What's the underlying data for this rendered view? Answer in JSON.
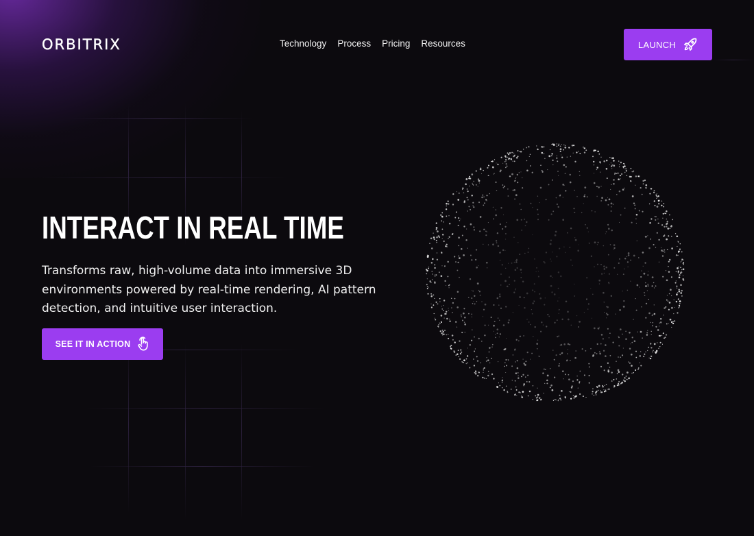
{
  "brand": {
    "logo_text": "ORBITRIX"
  },
  "nav": {
    "items": [
      {
        "label": "Technology"
      },
      {
        "label": "Process"
      },
      {
        "label": "Pricing"
      },
      {
        "label": "Resources"
      }
    ]
  },
  "header": {
    "launch_label": "LAUNCH",
    "launch_icon": "rocket-icon"
  },
  "hero": {
    "title": "INTERACT IN REAL TIME",
    "description": "Transforms raw, high-volume data into immersive 3D environments powered by real-time rendering, AI pattern detection, and intuitive user interaction.",
    "cta_label": "SEE IT IN ACTION",
    "cta_icon": "hand-pointer-icon"
  },
  "colors": {
    "background": "#0c0a0e",
    "accent": "#9b3df0",
    "text": "#ffffff"
  }
}
